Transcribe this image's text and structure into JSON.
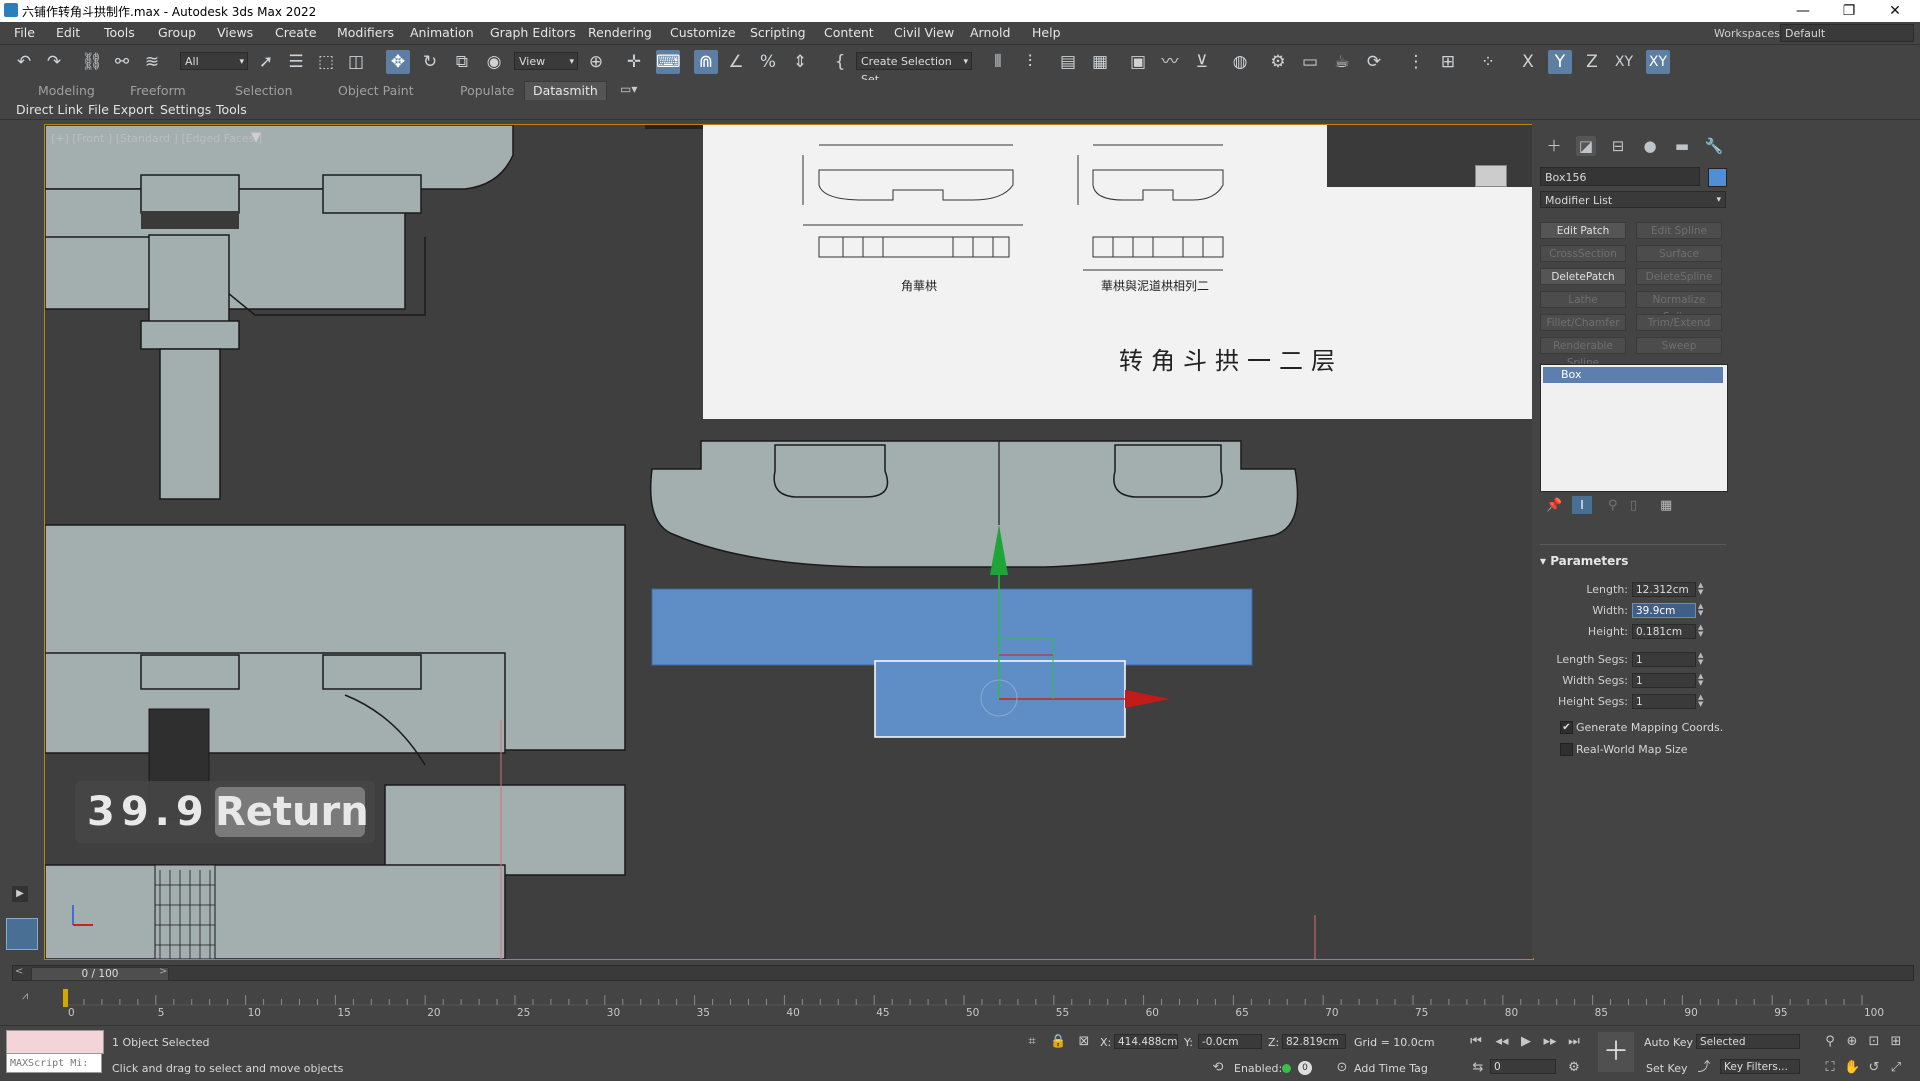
{
  "window": {
    "title": "六铺作转角斗拱制作.max - Autodesk 3ds Max 2022",
    "minimize": "—",
    "restore": "❐",
    "close": "✕"
  },
  "menu": [
    "File",
    "Edit",
    "Tools",
    "Group",
    "Views",
    "Create",
    "Modifiers",
    "Animation",
    "Graph Editors",
    "Rendering",
    "Customize",
    "Scripting",
    "Content",
    "Civil View",
    "Arnold",
    "Help"
  ],
  "workspaces": {
    "label": "Workspaces:",
    "value": "Default"
  },
  "toolbar": {
    "selection_filter": "All",
    "ref_coord": "View",
    "named_selection": "Create Selection Set",
    "axis_x": "X",
    "axis_y": "Y",
    "axis_z": "Z",
    "axis_xy": "XY",
    "axis_xy2": "XY"
  },
  "ribbon": {
    "tabs": [
      "Modeling",
      "Freeform",
      "Selection",
      "Object Paint",
      "Populate",
      "Datasmith"
    ]
  },
  "subbar": {
    "items": [
      "Direct Link",
      "File Export",
      "Settings",
      "Tools"
    ]
  },
  "viewport": {
    "label": "[+] [Front ] [Standard ] [Edged Faces ]",
    "ref_caption_1": "角華栱",
    "ref_caption_2": "華栱與泥道栱相列二",
    "ref_title": "转角斗拱一二层",
    "input_value": "39.9",
    "input_return": "Return"
  },
  "command_panel": {
    "object_name": "Box156",
    "object_color": "#4f8fd6",
    "modifier_list": "Modifier List",
    "modifier_buttons": [
      {
        "label": "Edit Patch",
        "enabled": true
      },
      {
        "label": "Edit Spline",
        "enabled": false
      },
      {
        "label": "CrossSection",
        "enabled": false
      },
      {
        "label": "Surface",
        "enabled": false
      },
      {
        "label": "DeletePatch",
        "enabled": true
      },
      {
        "label": "DeleteSpline",
        "enabled": false
      },
      {
        "label": "Lathe",
        "enabled": false
      },
      {
        "label": "Normalize Spline",
        "enabled": false
      },
      {
        "label": "Fillet/Chamfer",
        "enabled": false
      },
      {
        "label": "Trim/Extend",
        "enabled": false
      },
      {
        "label": "Renderable Spline",
        "enabled": false
      },
      {
        "label": "Sweep",
        "enabled": false
      }
    ],
    "stack_item": "Box",
    "params_title": "Parameters",
    "params": {
      "length_label": "Length:",
      "length_value": "12.312cm",
      "width_label": "Width:",
      "width_value": "39.9cm",
      "height_label": "Height:",
      "height_value": "0.181cm",
      "length_segs_label": "Length Segs:",
      "length_segs_value": "1",
      "width_segs_label": "Width Segs:",
      "width_segs_value": "1",
      "height_segs_label": "Height Segs:",
      "height_segs_value": "1"
    },
    "gen_mapping": "Generate Mapping Coords.",
    "gen_mapping_checked": true,
    "real_world": "Real-World Map Size",
    "real_world_checked": false
  },
  "timeline": {
    "frame_display": "0 / 100",
    "ticks": [
      "0",
      "5",
      "10",
      "15",
      "20",
      "25",
      "30",
      "35",
      "40",
      "45",
      "50",
      "55",
      "60",
      "65",
      "70",
      "75",
      "80",
      "85",
      "90",
      "95",
      "100"
    ]
  },
  "status": {
    "maxscript": "MAXScript Mi:",
    "selected": "1 Object Selected",
    "prompt": "Click and drag to select and move objects",
    "x_label": "X:",
    "x_value": "414.488cm",
    "y_label": "Y:",
    "y_value": "-0.0cm",
    "z_label": "Z:",
    "z_value": "82.819cm",
    "grid": "Grid = 10.0cm",
    "enabled": "Enabled:",
    "add_time_tag": "Add Time Tag",
    "auto_key": "Auto Key",
    "set_key": "Set Key",
    "key_mode": "Selected",
    "key_filters": "Key Filters...",
    "frame": "0"
  }
}
